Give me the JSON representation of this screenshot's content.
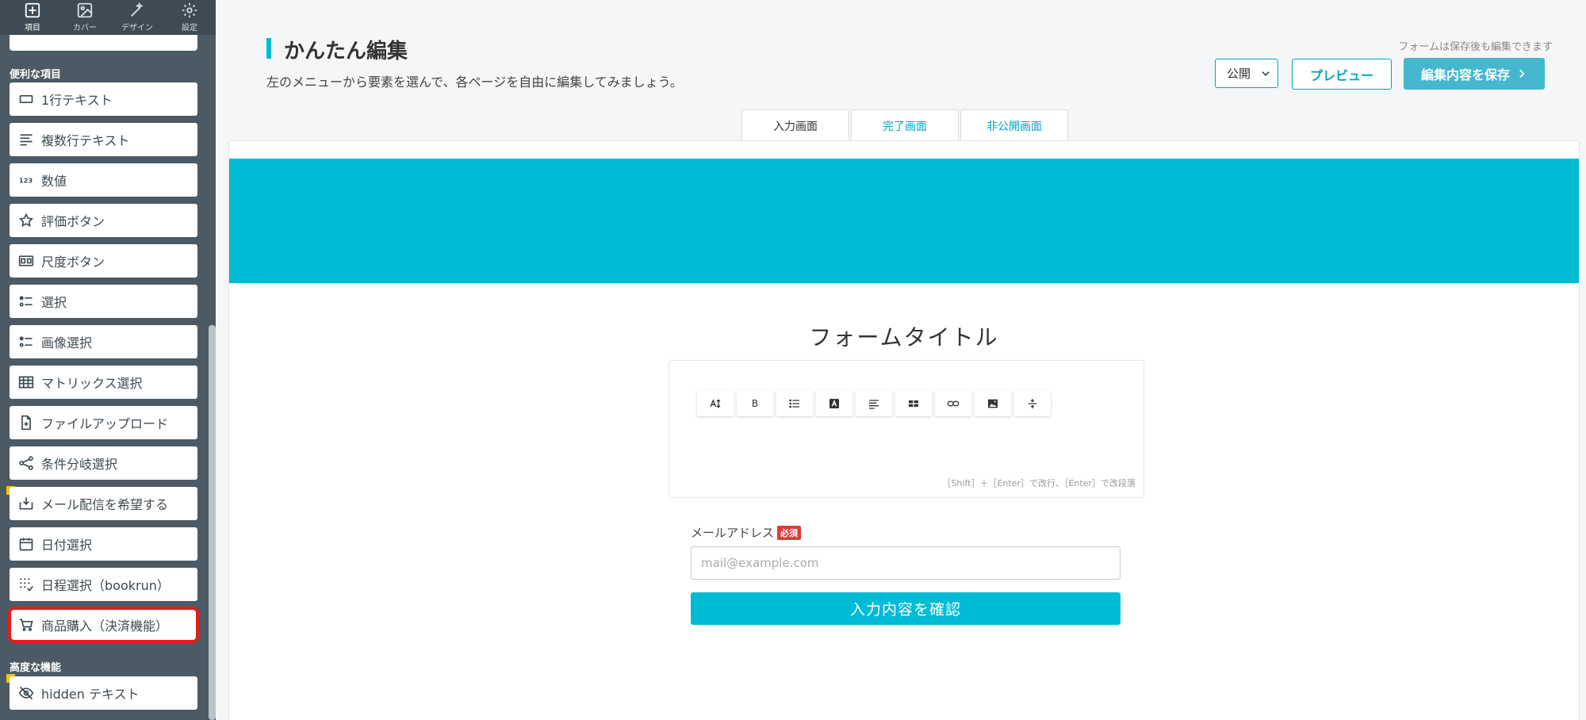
{
  "sidebar": {
    "nav": [
      {
        "label": "項目",
        "icon": "plus-square-icon"
      },
      {
        "label": "カバー",
        "icon": "image-icon"
      },
      {
        "label": "デザイン",
        "icon": "wand-icon"
      },
      {
        "label": "設定",
        "icon": "gear-icon"
      }
    ],
    "section_useful": "便利な項目",
    "items": [
      {
        "label": "1行テキスト",
        "icon": "single-line-text-icon"
      },
      {
        "label": "複数行テキスト",
        "icon": "multi-line-text-icon"
      },
      {
        "label": "数値",
        "icon": "number-icon"
      },
      {
        "label": "評価ボタン",
        "icon": "star-icon"
      },
      {
        "label": "尺度ボタン",
        "icon": "scale-icon"
      },
      {
        "label": "選択",
        "icon": "choice-list-icon"
      },
      {
        "label": "画像選択",
        "icon": "image-choice-icon"
      },
      {
        "label": "マトリックス選択",
        "icon": "table-icon"
      },
      {
        "label": "ファイルアップロード",
        "icon": "file-add-icon"
      },
      {
        "label": "条件分岐選択",
        "icon": "share-icon"
      },
      {
        "label": "メール配信を希望する",
        "icon": "mail-download-icon"
      },
      {
        "label": "日付選択",
        "icon": "calendar-icon"
      },
      {
        "label": "日程選択（bookrun）",
        "icon": "schedule-dots-icon"
      },
      {
        "label": "商品購入（決済機能）",
        "icon": "cart-icon"
      }
    ],
    "section_advanced": "高度な機能",
    "advanced_items": [
      {
        "label": "hidden テキスト",
        "icon": "eye-off-icon"
      }
    ]
  },
  "header": {
    "title": "かんたん編集",
    "description": "左のメニューから要素を選んで、各ページを自由に編集してみましょう。",
    "save_note": "フォームは保存後も編集できます",
    "publish_label": "公開",
    "preview_label": "プレビュー",
    "save_label": "編集内容を保存"
  },
  "tabs": [
    {
      "label": "入力画面",
      "active": true
    },
    {
      "label": "完了画面",
      "active": false
    },
    {
      "label": "非公開画面",
      "active": false
    }
  ],
  "form": {
    "banner_color": "#00bbd3",
    "title": "フォームタイトル",
    "toolbar": [
      "font-size-icon",
      "bold-icon",
      "list-icon",
      "text-color-icon",
      "align-icon",
      "table-icon",
      "link-icon",
      "image-icon",
      "divider-icon"
    ],
    "bold_glyph": "B",
    "editor_hint": "［Shift］＋［Enter］で改行、［Enter］で改段落",
    "email_label": "メールアドレス",
    "required_badge": "必須",
    "email_placeholder": "mail@example.com",
    "confirm_label": "入力内容を確認"
  },
  "colors": {
    "accent": "#00bbd3",
    "sidebar": "#4b5a64",
    "highlight": "#e11d1d",
    "required": "#e03a3a"
  }
}
